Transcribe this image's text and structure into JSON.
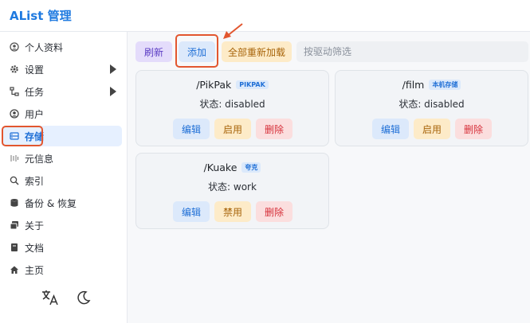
{
  "app": {
    "title": "AList 管理"
  },
  "sidebar": {
    "items": [
      {
        "label": "个人资料"
      },
      {
        "label": "设置"
      },
      {
        "label": "任务"
      },
      {
        "label": "用户"
      },
      {
        "label": "存储"
      },
      {
        "label": "元信息"
      },
      {
        "label": "索引"
      },
      {
        "label": "备份 & 恢复"
      },
      {
        "label": "关于"
      },
      {
        "label": "文档"
      },
      {
        "label": "主页"
      }
    ]
  },
  "toolbar": {
    "refresh_label": "刷新",
    "add_label": "添加",
    "reload_all_label": "全部重新加载",
    "filter_placeholder": "按驱动筛选"
  },
  "storages": [
    {
      "path": "/PikPak",
      "driver": "PIKPAK",
      "status": "状态: disabled",
      "edit": "编辑",
      "toggle": "启用",
      "delete": "删除"
    },
    {
      "path": "/film",
      "driver": "本机存储",
      "status": "状态: disabled",
      "edit": "编辑",
      "toggle": "启用",
      "delete": "删除"
    },
    {
      "path": "/Kuake",
      "driver": "夸克",
      "status": "状态: work",
      "edit": "编辑",
      "toggle": "禁用",
      "delete": "删除"
    }
  ],
  "colors": {
    "accent": "#1f7ae0",
    "highlight": "#e2562f"
  }
}
